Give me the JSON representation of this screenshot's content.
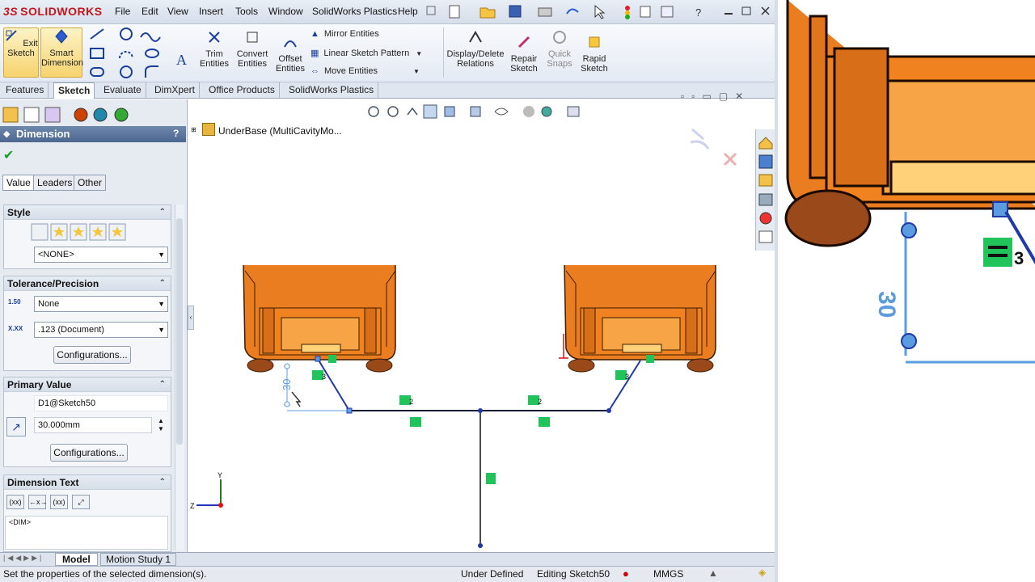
{
  "app": {
    "logo": "SOLIDWORKS",
    "logo_prefix": "3S"
  },
  "menu": [
    "File",
    "Edit",
    "View",
    "Insert",
    "Tools",
    "Window",
    "SolidWorks Plastics",
    "Help"
  ],
  "ribbon": {
    "exit_sketch": "Exit Sketch",
    "smart_dimension": "Smart Dimension",
    "trim_entities": "Trim Entities",
    "convert_entities": "Convert Entities",
    "offset_entities": "Offset Entities",
    "mirror_entities": "Mirror Entities",
    "linear_sketch_pattern": "Linear Sketch Pattern",
    "move_entities": "Move Entities",
    "display_delete_relations": "Display/Delete Relations",
    "repair_sketch": "Repair Sketch",
    "quick_snaps": "Quick Snaps",
    "rapid_sketch": "Rapid Sketch"
  },
  "tabs": [
    "Features",
    "Sketch",
    "Evaluate",
    "DimXpert",
    "Office Products",
    "SolidWorks Plastics"
  ],
  "active_tab": "Sketch",
  "property_manager": {
    "title": "Dimension",
    "help": "?",
    "subtabs": [
      "Value",
      "Leaders",
      "Other"
    ],
    "style": {
      "header": "Style",
      "dropdown": "<NONE>"
    },
    "tolerance": {
      "header": "Tolerance/Precision",
      "tolerance_type": "None",
      "precision": ".123 (Document)",
      "configurations": "Configurations...",
      "tol_icon": "1.50",
      "prec_icon": "X.XX"
    },
    "primary_value": {
      "header": "Primary Value",
      "name": "D1@Sketch50",
      "value": "30.000mm",
      "configurations": "Configurations..."
    },
    "dimension_text": {
      "header": "Dimension Text",
      "text": "<DIM>",
      "btn1": "(xx)",
      "btn2": "←x→",
      "btn3": "(xx)"
    }
  },
  "tree": {
    "item": "UnderBase  (MultiCavityMo..."
  },
  "sketch": {
    "dim_value": "30",
    "relation_labels": [
      "3",
      "2",
      "2",
      "3"
    ],
    "axis_x": "Z",
    "axis_y": "Y"
  },
  "bottom_tabs": [
    "Model",
    "Motion Study 1"
  ],
  "status": {
    "message": "Set the properties of the selected dimension(s).",
    "state": "Under Defined",
    "editing": "Editing Sketch50",
    "units": "MMGS"
  },
  "zoom": {
    "dim_value": "30",
    "relation_label": "3"
  },
  "colors": {
    "accent": "#f07f1c",
    "sketch_line": "#1f3aa8",
    "dim_blue": "#5b9be0",
    "relation_green": "#21c35b"
  }
}
